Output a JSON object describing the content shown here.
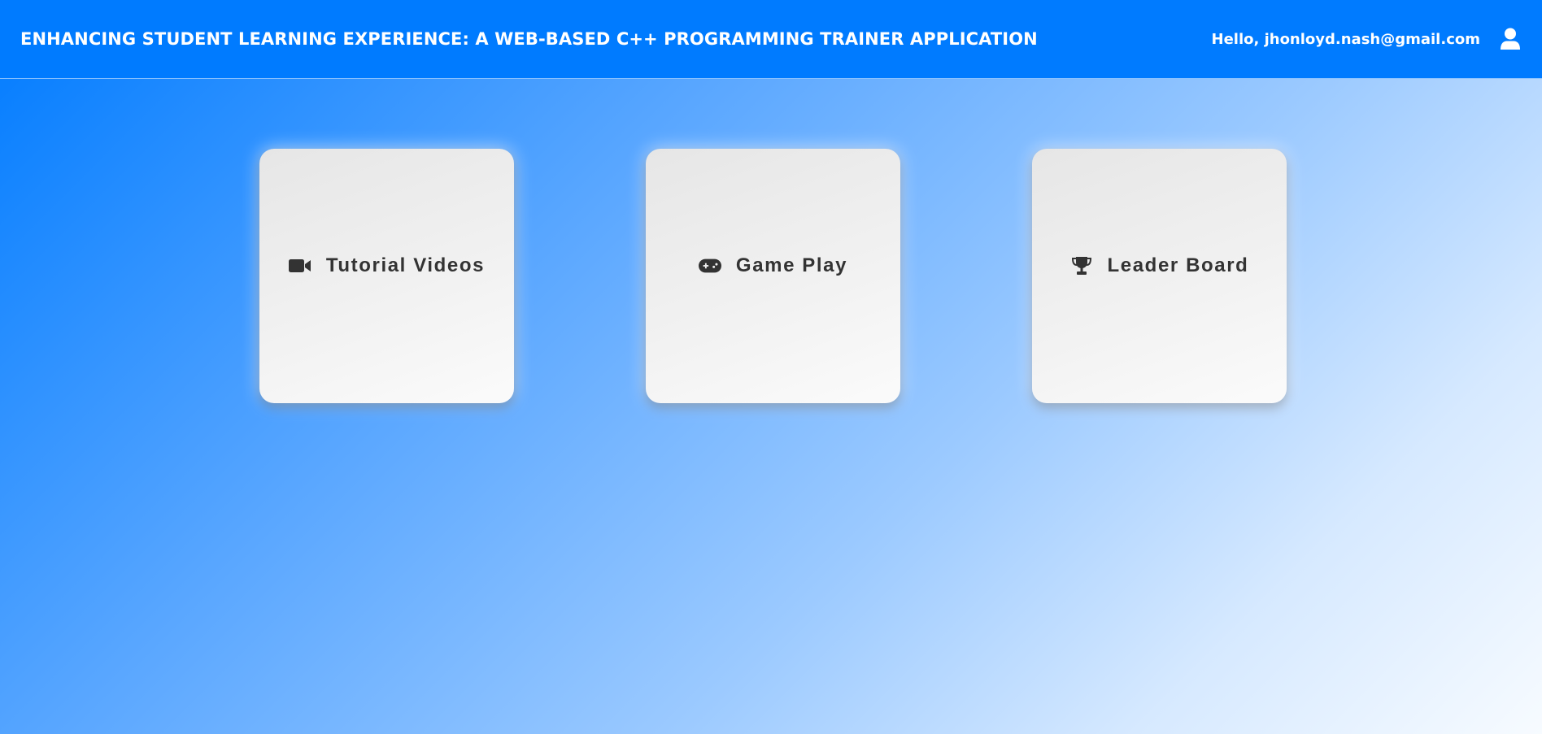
{
  "header": {
    "title": "ENHANCING STUDENT LEARNING EXPERIENCE: A WEB-BASED C++ PROGRAMMING TRAINER APPLICATION",
    "greeting": "Hello, jhonloyd.nash@gmail.com",
    "user_icon": "user-icon",
    "background_color": "#007bff"
  },
  "cards": [
    {
      "label": "Tutorial Videos",
      "icon": "video-camera-icon"
    },
    {
      "label": "Game Play",
      "icon": "gamepad-icon"
    },
    {
      "label": "Leader Board",
      "icon": "trophy-icon"
    }
  ],
  "colors": {
    "accent": "#007bff",
    "card_text": "#333333",
    "card_background": "#f0f0f0"
  }
}
